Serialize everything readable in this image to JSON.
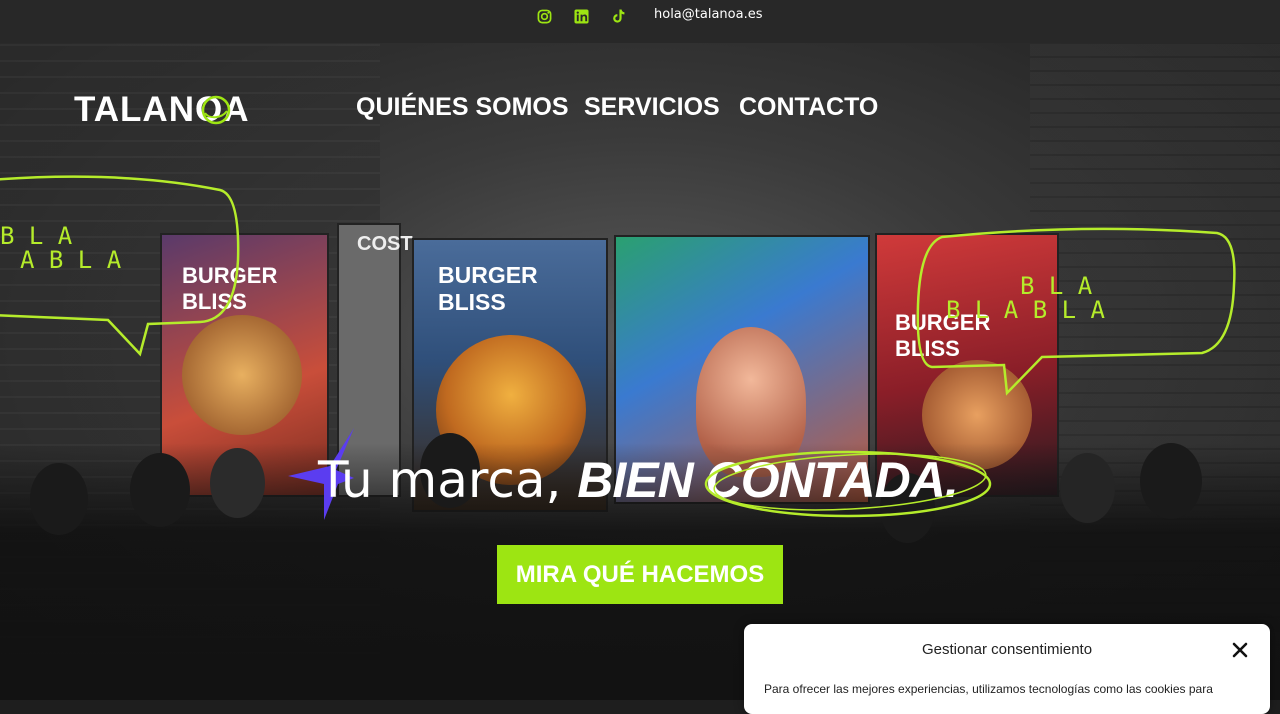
{
  "topbar": {
    "social": [
      "instagram-icon",
      "linkedin-icon",
      "tiktok-icon"
    ],
    "email": "hola@talanoa.es",
    "accent_color": "#9de512"
  },
  "header": {
    "logo_text": "TALANOA",
    "nav": [
      "QUIÉNES SOMOS",
      "SERVICIOS",
      "CONTACTO"
    ]
  },
  "hero": {
    "bubble_left": {
      "row1": "B L A",
      "row2": "A B L A"
    },
    "bubble_right": {
      "row1": "B L A",
      "row2": "B L A B L A"
    },
    "headline_plain": "Tu marca,",
    "headline_bold": "BIEN CONTADA.",
    "cta_label": "MIRA QUÉ HACEMOS",
    "poster_text": "BURGER BLISS",
    "poster_text_small": "COST"
  },
  "consent": {
    "title": "Gestionar consentimiento",
    "body": "Para ofrecer las mejores experiencias, utilizamos tecnologías como las cookies para"
  }
}
